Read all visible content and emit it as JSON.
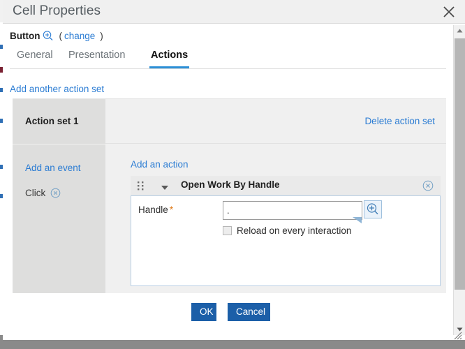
{
  "window": {
    "title": "Cell Properties",
    "close_icon": "close-x-icon"
  },
  "breadcrumb": {
    "element_label": "Button",
    "zoom_icon": "magnifier-plus-icon",
    "paren_open": "(",
    "change_label": "change",
    "paren_close": ")"
  },
  "tabs": [
    {
      "label": "General",
      "active": false
    },
    {
      "label": "Presentation",
      "active": false
    },
    {
      "label": "Actions",
      "active": true
    }
  ],
  "links": {
    "add_another_action_set": "Add another action set",
    "delete_action_set": "Delete action set",
    "add_an_event": "Add an event",
    "add_an_action": "Add an action"
  },
  "action_set": {
    "title": "Action set 1",
    "events": [
      {
        "label": "Click",
        "remove_icon": "remove-circle-x-icon"
      }
    ],
    "actions": [
      {
        "title": "Open Work By Handle",
        "drag_icon": "drag-dots-icon",
        "collapse_icon": "caret-down-icon",
        "remove_icon": "remove-circle-x-icon",
        "fields": [
          {
            "label": "Handle",
            "required_marker": "*",
            "value": ".",
            "placeholder": "",
            "picker_icon": "magnifier-plus-icon"
          }
        ],
        "checkbox": {
          "label": "Reload on every interaction",
          "checked": false
        }
      }
    ]
  },
  "footer": {
    "ok_label": "OK",
    "cancel_label": "Cancel"
  },
  "scrollbar": {
    "up_icon": "scroll-up-arrow-icon",
    "down_icon": "scroll-down-arrow-icon"
  },
  "colors": {
    "accent_link": "#2b7cd3",
    "tab_active_underline": "#2b8fd6",
    "primary_button": "#1c5fa8",
    "required_star": "#e07b1a",
    "panel_bg": "#f0f0f0",
    "left_column_bg": "#dededd"
  }
}
